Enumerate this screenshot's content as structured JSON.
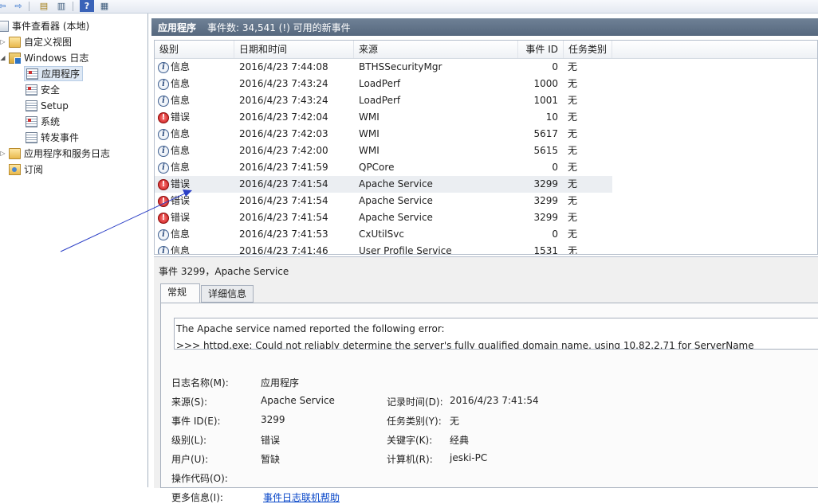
{
  "tree": {
    "root_label": "事件查看器 (本地)",
    "custom_views_label": "自定义视图",
    "windows_logs_label": "Windows 日志",
    "application_label": "应用程序",
    "security_label": "安全",
    "setup_label": "Setup",
    "system_label": "系统",
    "forwarded_label": "转发事件",
    "app_service_logs_label": "应用程序和服务日志",
    "subscriptions_label": "订阅"
  },
  "log_header": {
    "name": "应用程序",
    "count_text": "事件数: 34,541 (!) 可用的新事件"
  },
  "columns": {
    "level": "级别",
    "datetime": "日期和时间",
    "source": "来源",
    "event_id": "事件 ID",
    "task_category": "任务类别"
  },
  "events": [
    {
      "level": "信息",
      "type": "info",
      "datetime": "2016/4/23 7:44:08",
      "source": "BTHSSecurityMgr",
      "event_id": "0",
      "task": "无"
    },
    {
      "level": "信息",
      "type": "info",
      "datetime": "2016/4/23 7:43:24",
      "source": "LoadPerf",
      "event_id": "1000",
      "task": "无"
    },
    {
      "level": "信息",
      "type": "info",
      "datetime": "2016/4/23 7:43:24",
      "source": "LoadPerf",
      "event_id": "1001",
      "task": "无"
    },
    {
      "level": "错误",
      "type": "error",
      "datetime": "2016/4/23 7:42:04",
      "source": "WMI",
      "event_id": "10",
      "task": "无"
    },
    {
      "level": "信息",
      "type": "info",
      "datetime": "2016/4/23 7:42:03",
      "source": "WMI",
      "event_id": "5617",
      "task": "无"
    },
    {
      "level": "信息",
      "type": "info",
      "datetime": "2016/4/23 7:42:00",
      "source": "WMI",
      "event_id": "5615",
      "task": "无"
    },
    {
      "level": "信息",
      "type": "info",
      "datetime": "2016/4/23 7:41:59",
      "source": "QPCore",
      "event_id": "0",
      "task": "无"
    },
    {
      "level": "错误",
      "type": "error",
      "datetime": "2016/4/23 7:41:54",
      "source": "Apache Service",
      "event_id": "3299",
      "task": "无"
    },
    {
      "level": "错误",
      "type": "error",
      "datetime": "2016/4/23 7:41:54",
      "source": "Apache Service",
      "event_id": "3299",
      "task": "无"
    },
    {
      "level": "错误",
      "type": "error",
      "datetime": "2016/4/23 7:41:54",
      "source": "Apache Service",
      "event_id": "3299",
      "task": "无"
    },
    {
      "level": "信息",
      "type": "info",
      "datetime": "2016/4/23 7:41:53",
      "source": "CxUtilSvc",
      "event_id": "0",
      "task": "无"
    },
    {
      "level": "信息",
      "type": "info",
      "datetime": "2016/4/23 7:41:46",
      "source": "User Profile Service",
      "event_id": "1531",
      "task": "无"
    }
  ],
  "detail": {
    "title": "事件 3299，Apache Service",
    "tab_general": "常规",
    "tab_details": "详细信息",
    "desc_line1": "The Apache service named  reported the following error:",
    "desc_line2": ">>> httpd.exe: Could not reliably determine the server's fully qualified domain name, using 10.82.2.71 for ServerName",
    "log_name_label": "日志名称(M):",
    "log_name_value": "应用程序",
    "source_label": "来源(S):",
    "source_value": "Apache Service",
    "logged_label": "记录时间(D):",
    "logged_value": "2016/4/23 7:41:54",
    "event_id_label": "事件 ID(E):",
    "event_id_value": "3299",
    "task_label": "任务类别(Y):",
    "task_value": "无",
    "level_label": "级别(L):",
    "level_value": "错误",
    "keywords_label": "关键字(K):",
    "keywords_value": "经典",
    "user_label": "用户(U):",
    "user_value": "暂缺",
    "computer_label": "计算机(R):",
    "computer_value": "jeski-PC",
    "opcode_label": "操作代码(O):",
    "more_info_label": "更多信息(I):",
    "more_info_link": "事件日志联机帮助"
  },
  "colors": {
    "title_bar": "#5f7187",
    "selected_row": "#ebeef2",
    "error_icon": "#c41414",
    "info_icon": "#3f5f8f",
    "annotation_line": "#2b3fc6",
    "link": "#0645c8"
  }
}
